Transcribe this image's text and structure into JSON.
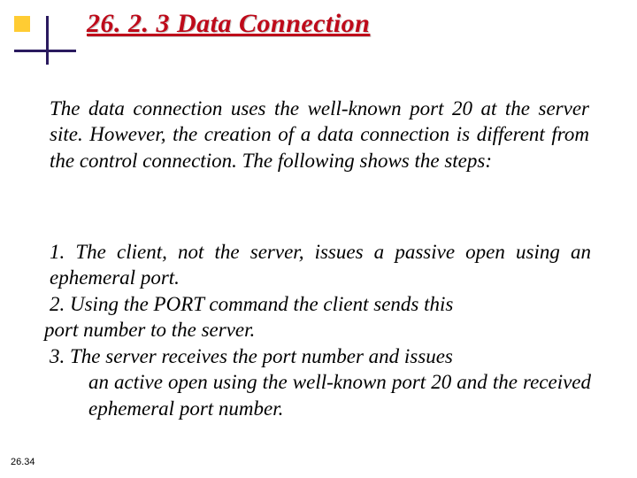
{
  "title": "26. 2. 3  Data Connection",
  "intro": "The data connection uses the well-known port 20 at the server site. However, the creation of a data connection is different from the control connection. The following shows the steps:",
  "steps": {
    "s1": "1. The client, not the server, issues a passive open using an ephemeral port.",
    "s2a": "2. Using the PORT command the client sends this",
    "s2b": " port number to the server.",
    "s3a": "3.   The server receives the port number and issues",
    "s3b": "an active open using the well-known port 20 and the received ephemeral port number."
  },
  "page_number": "26.34"
}
